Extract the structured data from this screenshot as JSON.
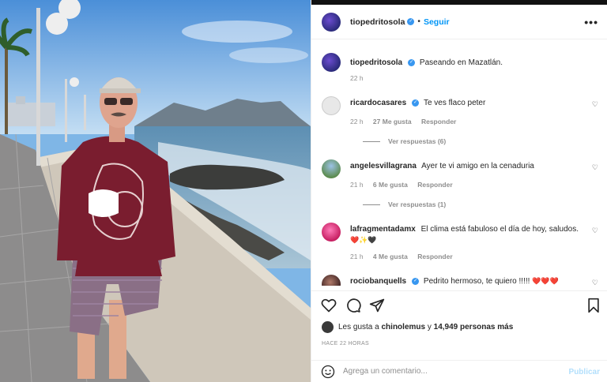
{
  "post": {
    "author": "tiopedritosola",
    "follow_label": "Seguir",
    "dot": "•",
    "more_icon": "more-horizontal-icon",
    "caption": "Paseando en Mazatlán.",
    "caption_time": "22 h"
  },
  "comments": [
    {
      "user": "ricardocasares",
      "verified": true,
      "text": "Te ves flaco peter",
      "time": "22 h",
      "likes": "27 Me gusta",
      "reply": "Responder",
      "replies": "Ver respuestas (6)"
    },
    {
      "user": "angelesvillagrana",
      "verified": false,
      "text": "Ayer te vi amigo en la cenaduria",
      "time": "21 h",
      "likes": "6 Me gusta",
      "reply": "Responder",
      "replies": "Ver respuestas (1)"
    },
    {
      "user": "lafragmentadamx",
      "verified": false,
      "text": "El clima está fabuloso el día de hoy, saludos.",
      "emoji": "❤️✨🖤",
      "time": "21 h",
      "likes": "4 Me gusta",
      "reply": "Responder"
    },
    {
      "user": "rociobanquells",
      "verified": true,
      "text": "Pedrito hermoso, te quiero !!!!!",
      "emoji": "❤️❤️❤️"
    }
  ],
  "likes": {
    "prefix": "Les gusta a",
    "user": "chinolemus",
    "middle": "y",
    "count": "14,949 personas más"
  },
  "timestamp": "HACE 22 HORAS",
  "comment_box": {
    "placeholder": "Agrega un comentario...",
    "publish": "Publicar"
  },
  "colors": {
    "link_blue": "#0095f6",
    "publish_disabled": "#b2dffc",
    "muted": "#8e8e8e"
  }
}
